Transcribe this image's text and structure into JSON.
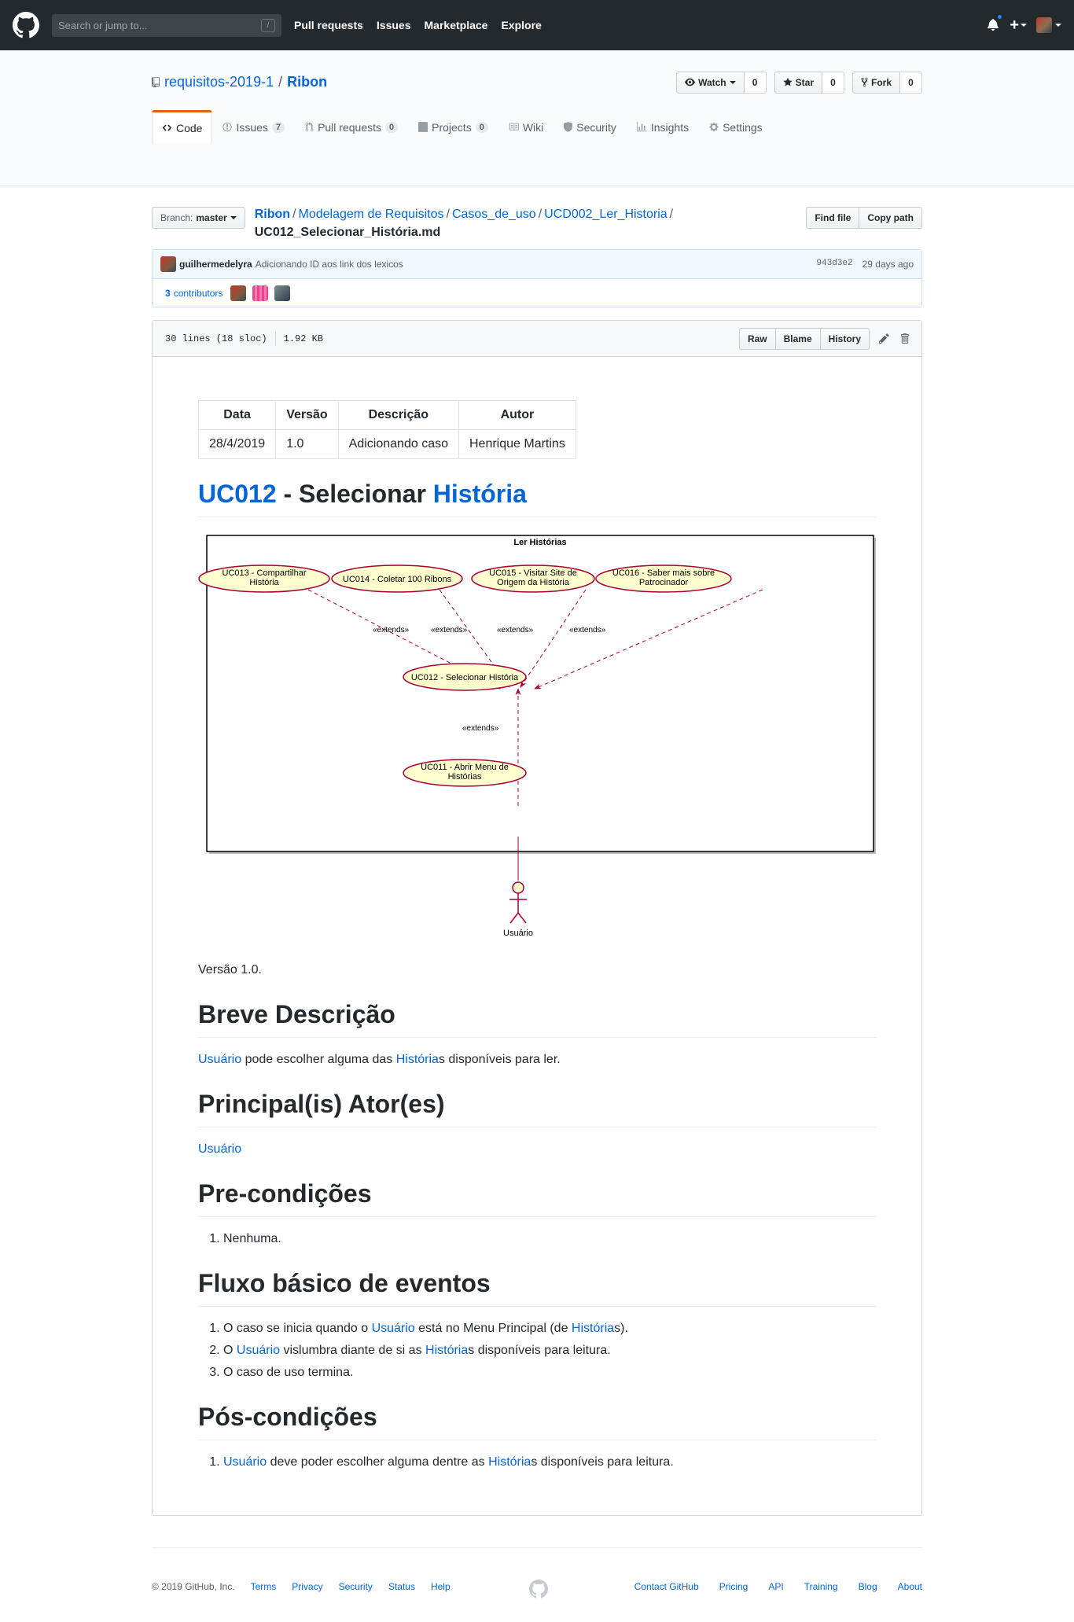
{
  "header": {
    "search_placeholder": "Search or jump to...",
    "search_shortcut": "/",
    "nav": [
      "Pull requests",
      "Issues",
      "Marketplace",
      "Explore"
    ],
    "plus_label": "+"
  },
  "repo": {
    "owner": "requisitos-2019-1",
    "separator": "/",
    "name": "Ribon",
    "watch": {
      "label": "Watch",
      "count": "0"
    },
    "star": {
      "label": "Star",
      "count": "0"
    },
    "fork": {
      "label": "Fork",
      "count": "0"
    },
    "tabs": [
      {
        "label": "Code"
      },
      {
        "label": "Issues",
        "counter": "7"
      },
      {
        "label": "Pull requests",
        "counter": "0"
      },
      {
        "label": "Projects",
        "counter": "0"
      },
      {
        "label": "Wiki"
      },
      {
        "label": "Security"
      },
      {
        "label": "Insights"
      },
      {
        "label": "Settings"
      }
    ]
  },
  "file_nav": {
    "branch_label": "Branch:",
    "branch_value": "master",
    "crumbs": [
      "Ribon",
      "Modelagem de Requisitos",
      "Casos_de_uso",
      "UCD002_Ler_Historia"
    ],
    "filename": "UC012_Selecionar_História.md",
    "find_file": "Find file",
    "copy_path": "Copy path"
  },
  "commit": {
    "author": "guilhermedelyra",
    "message": "Adicionando ID aos link dos lexicos",
    "sha": "943d3e2",
    "age": "29 days ago",
    "contributors_count": "3",
    "contributors_label": "contributors"
  },
  "file": {
    "lines": "30 lines (18 sloc)",
    "size": "1.92 KB",
    "raw": "Raw",
    "blame": "Blame",
    "history": "History"
  },
  "doc": {
    "table": {
      "headers": [
        "Data",
        "Versão",
        "Descrição",
        "Autor"
      ],
      "row": [
        "28/4/2019",
        "1.0",
        "Adicionando caso",
        "Henrique Martins"
      ]
    },
    "title_link1": "UC012",
    "title_mid": " - Selecionar ",
    "title_link2": "História",
    "diagram": {
      "package_title": "Ler Histórias",
      "uc013_l1": "UC013 - Compartilhar",
      "uc013_l2": "História",
      "uc014": "UC014 - Coletar 100 Ribons",
      "uc015_l1": "UC015 - Visitar Site de",
      "uc015_l2": "Origem da História",
      "uc016_l1": "UC016 - Saber mais sobre",
      "uc016_l2": "Patrocinador",
      "uc012": "UC012 - Selecionar História",
      "uc011_l1": "UC011 - Abrir Menu de",
      "uc011_l2": "Histórias",
      "extends": "«extends»",
      "actor": "Usuário"
    },
    "version": "Versão 1.0.",
    "h_desc": "Breve Descrição",
    "desc_link1": "Usuário",
    "desc_mid": " pode escolher alguma das ",
    "desc_link2": "História",
    "desc_end": "s disponíveis para ler.",
    "h_actor": "Principal(is) Ator(es)",
    "actor_link": "Usuário",
    "h_pre": "Pre-condições",
    "pre_1": "Nenhuma.",
    "h_flow": "Fluxo básico de eventos",
    "flow_1a": "O caso se inicia quando o ",
    "flow_1_link1": "Usuário",
    "flow_1b": " está no Menu Principal (de ",
    "flow_1_link2": "História",
    "flow_1c": "s).",
    "flow_2a": "O ",
    "flow_2_link1": "Usuário",
    "flow_2b": " vislumbra diante de si as ",
    "flow_2_link2": "História",
    "flow_2c": "s disponíveis para leitura.",
    "flow_3": "O caso de uso termina.",
    "h_post": "Pós-condições",
    "post_1_link1": "Usuário",
    "post_1a": " deve poder escolher alguma dentre as ",
    "post_1_link2": "História",
    "post_1b": "s disponíveis para leitura."
  },
  "footer": {
    "copyright": "© 2019 GitHub, Inc.",
    "left_links": [
      "Terms",
      "Privacy",
      "Security",
      "Status",
      "Help"
    ],
    "right_links": [
      "Contact GitHub",
      "Pricing",
      "API",
      "Training",
      "Blog",
      "About"
    ]
  },
  "colors": {
    "header_bg": "#24292e",
    "link": "#0366d6",
    "tab_accent": "#e36209",
    "uml_border": "#a80036",
    "uml_fill": "#fefece"
  }
}
